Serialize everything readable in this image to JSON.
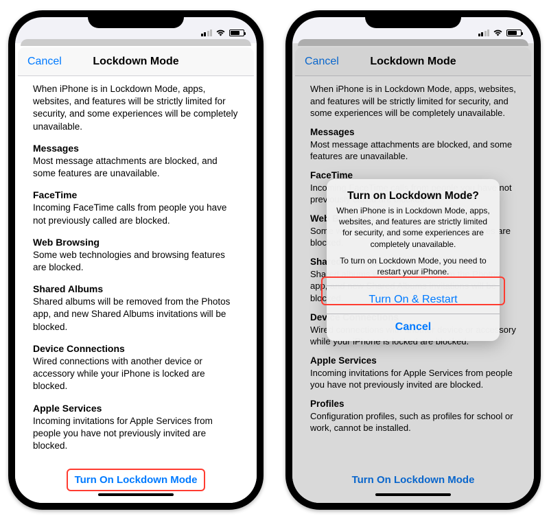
{
  "colors": {
    "link": "#007aff",
    "highlight": "#ff3b30"
  },
  "nav": {
    "cancel": "Cancel",
    "title": "Lockdown Mode"
  },
  "intro": "When iPhone is in Lockdown Mode, apps, websites, and features will be strictly limited for security, and some experiences will be completely unavailable.",
  "sections": {
    "messages": {
      "title": "Messages",
      "body": "Most message attachments are blocked, and some features are unavailable."
    },
    "facetime": {
      "title": "FaceTime",
      "body": "Incoming FaceTime calls from people you have not previously called are blocked."
    },
    "web": {
      "title": "Web Browsing",
      "body": "Some web technologies and browsing features are blocked."
    },
    "albums": {
      "title": "Shared Albums",
      "body": "Shared albums will be removed from the Photos app, and new Shared Albums invitations will be blocked."
    },
    "device": {
      "title": "Device Connections",
      "body": "Wired connections with another device or accessory while your iPhone is locked are blocked."
    },
    "services": {
      "title": "Apple Services",
      "body": "Incoming invitations for Apple Services from people you have not previously invited are blocked."
    },
    "profiles": {
      "title": "Profiles",
      "body": "Configuration profiles, such as profiles for school or work, cannot be installed."
    }
  },
  "footer": {
    "turn_on": "Turn On Lockdown Mode"
  },
  "alert": {
    "title": "Turn on Lockdown Mode?",
    "message": "When iPhone is in Lockdown Mode, apps, websites, and features are strictly limited for security, and some experiences are completely unavailable.",
    "sub": "To turn on Lockdown Mode, you need to restart your iPhone.",
    "primary": "Turn On & Restart",
    "secondary": "Cancel"
  }
}
